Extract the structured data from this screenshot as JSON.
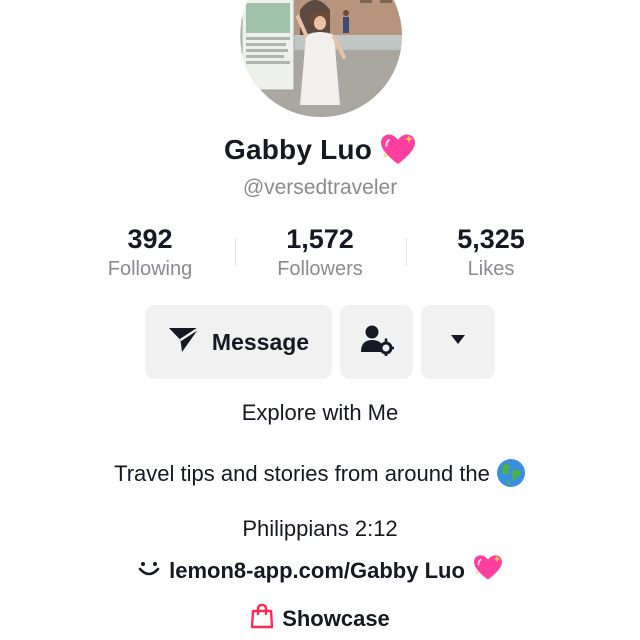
{
  "profile": {
    "name": "Gabby Luo",
    "name_emoji": "sparkling-heart",
    "handle": "@versedtraveler"
  },
  "stats": [
    {
      "value": "392",
      "label": "Following"
    },
    {
      "value": "1,572",
      "label": "Followers"
    },
    {
      "value": "5,325",
      "label": "Likes"
    }
  ],
  "actions": {
    "message_label": "Message",
    "message_icon": "send-icon",
    "friend_icon": "user-settings-icon",
    "more_icon": "caret-down-icon"
  },
  "bio": {
    "title": "Explore with Me",
    "tagline": "Travel tips and stories from around the",
    "tagline_emoji": "globe-icon",
    "verse": "Philippians 2:12",
    "link": "lemon8-app.com/Gabby Luo",
    "link_icon": "lemon8-smile-icon",
    "link_emoji": "sparkling-heart"
  },
  "showcase": {
    "label": "Showcase",
    "icon": "shopping-bag-icon"
  },
  "colors": {
    "text": "#161823",
    "secondary": "#8a8b91",
    "button_bg": "#f1f1f2",
    "heart": "#ff3fa0",
    "bag": "#fe2c55"
  }
}
